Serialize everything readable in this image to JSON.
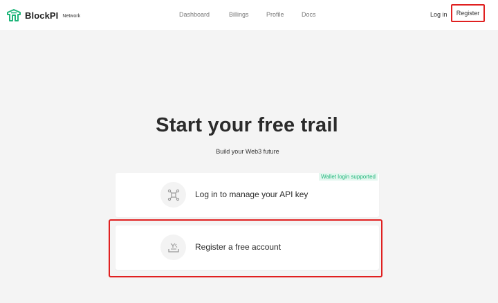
{
  "header": {
    "brand": "BlockPI",
    "brand_sub": "Network",
    "nav": [
      {
        "label": "Dashboard"
      },
      {
        "label": "Billings"
      },
      {
        "label": "Profile"
      },
      {
        "label": "Docs"
      }
    ],
    "login_label": "Log in",
    "register_label": "Register"
  },
  "hero": {
    "title": "Start your free trail",
    "subtitle": "Build your Web3 future"
  },
  "options": {
    "login": {
      "label": "Log in to manage your API key",
      "badge": "Wallet login supported",
      "icon": "network-nodes-icon"
    },
    "register": {
      "label": "Register a free account",
      "icon": "tray-download-icon"
    }
  },
  "colors": {
    "accent": "#1fb57a",
    "highlight": "#e02020",
    "background": "#f4f4f4"
  }
}
